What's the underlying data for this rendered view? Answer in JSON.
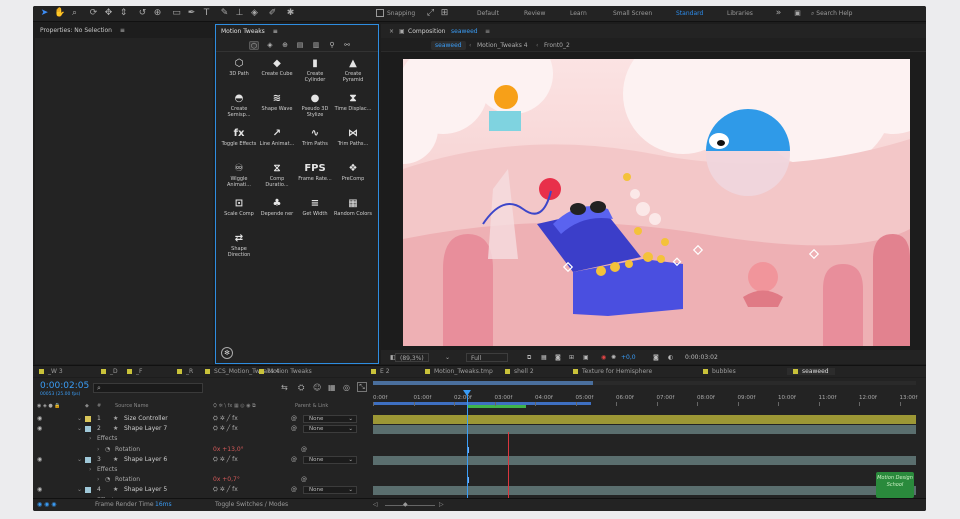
{
  "toolbar": {
    "snapping_label": "Snapping",
    "workspaces": [
      "Default",
      "Review",
      "Learn",
      "Small Screen",
      "Standard",
      "Libraries"
    ],
    "active_workspace": "Standard",
    "search_placeholder": "Search Help"
  },
  "properties": {
    "title": "Properties: No Selection"
  },
  "motion_tweaks": {
    "title": "Motion Tweaks",
    "tools": [
      {
        "icon": "3d-path-icon",
        "glyph": "⬡",
        "label": "3D Path"
      },
      {
        "icon": "cube-icon",
        "glyph": "◆",
        "label": "Create Cube"
      },
      {
        "icon": "cylinder-icon",
        "glyph": "▮",
        "label": "Create Cylinder"
      },
      {
        "icon": "pyramid-icon",
        "glyph": "▲",
        "label": "Create Pyramid"
      },
      {
        "icon": "semisphere-icon",
        "glyph": "◓",
        "label": "Create Semisp..."
      },
      {
        "icon": "wave-icon",
        "glyph": "≋",
        "label": "Shape Wave"
      },
      {
        "icon": "sphere-icon",
        "glyph": "●",
        "label": "Pseudo 3D Stylize"
      },
      {
        "icon": "hourglass-icon",
        "glyph": "⧗",
        "label": "Time Displac..."
      },
      {
        "icon": "fx-icon",
        "glyph": "fx",
        "label": "Toggle Effects"
      },
      {
        "icon": "line-animator-icon",
        "glyph": "↗",
        "label": "Line Animat..."
      },
      {
        "icon": "trim-paths-icon",
        "glyph": "∿",
        "label": "Trim Paths"
      },
      {
        "icon": "trim-paths-2-icon",
        "glyph": "⋈",
        "label": "Trim Paths..."
      },
      {
        "icon": "wiggle-icon",
        "glyph": "♾",
        "label": "Wiggle Animati..."
      },
      {
        "icon": "comp-duration-icon",
        "glyph": "⧖",
        "label": "Comp Duratio..."
      },
      {
        "icon": "fps-icon",
        "glyph": "FPS",
        "label": "Frame Rate..."
      },
      {
        "icon": "precomp-icon",
        "glyph": "❖",
        "label": "PreComp"
      },
      {
        "icon": "scale-comp-icon",
        "glyph": "⊡",
        "label": "Scale Comp"
      },
      {
        "icon": "dependencies-icon",
        "glyph": "♣",
        "label": "Depende ner"
      },
      {
        "icon": "get-width-icon",
        "glyph": "≡",
        "label": "Get Width"
      },
      {
        "icon": "random-colors-icon",
        "glyph": "▦",
        "label": "Random Colors"
      },
      {
        "icon": "shape-direction-icon",
        "glyph": "⇄",
        "label": "Shape Direction"
      }
    ]
  },
  "composition": {
    "header": "Composition",
    "comp_name": "seaweed",
    "breadcrumb": [
      "seaweed",
      "Motion_Tweaks 4",
      "Front0_2"
    ],
    "zoom": "(89,3%)",
    "resolution": "Full",
    "exposure": "+0,0",
    "timecode": "0:00:03:02"
  },
  "timeline": {
    "tabs": [
      {
        "label": "_W 3",
        "color": "#c9c23a"
      },
      {
        "label": "_D",
        "color": "#c9c23a"
      },
      {
        "label": "_F",
        "color": "#c9c23a"
      },
      {
        "label": "_R",
        "color": "#c9c23a"
      },
      {
        "label": "SCS_Motion_Tweaks 4",
        "color": "#c9c23a"
      },
      {
        "label": "Motion Tweaks",
        "color": "#c9c23a"
      },
      {
        "label": "E 2",
        "color": "#c9c23a"
      },
      {
        "label": "Motion_Tweaks.tmp",
        "color": "#c9c23a"
      },
      {
        "label": "shell 2",
        "color": "#c9c23a"
      },
      {
        "label": "Texture for Hemisphere",
        "color": "#c9c23a"
      },
      {
        "label": "bubbles",
        "color": "#c9c23a"
      },
      {
        "label": "seaweed",
        "color": "#c9c23a"
      }
    ],
    "current_time": "0:00:02:05",
    "fps_note": "00053 (25.00 fps)",
    "col_source": "Source Name",
    "col_parent": "Parent & Link",
    "ruler": [
      "0:00f",
      "01:00f",
      "02:00f",
      "03:00f",
      "04:00f",
      "05:00f",
      "06:00f",
      "07:00f",
      "08:00f",
      "09:00f",
      "10:00f",
      "11:00f",
      "12:00f",
      "13:00f"
    ],
    "layers": [
      {
        "kind": "layer",
        "num": "1",
        "name": "Size Controller",
        "color": "#d9c65a",
        "parent": "None",
        "bar": "#9c9735"
      },
      {
        "kind": "layer",
        "num": "2",
        "name": "Shape Layer 7",
        "color": "#9fc8d8",
        "parent": "None",
        "bar": "#5a6e6e"
      },
      {
        "kind": "group",
        "name": "Effects"
      },
      {
        "kind": "prop",
        "name": "Rotation",
        "value": "0x +13,0°"
      },
      {
        "kind": "layer",
        "num": "3",
        "name": "Shape Layer 6",
        "color": "#9fc8d8",
        "parent": "None",
        "bar": "#5a6e6e"
      },
      {
        "kind": "group",
        "name": "Effects"
      },
      {
        "kind": "prop",
        "name": "Rotation",
        "value": "0x +0,7°"
      },
      {
        "kind": "layer",
        "num": "4",
        "name": "Shape Layer 5",
        "color": "#9fc8d8",
        "parent": "None",
        "bar": "#5a6e6e"
      },
      {
        "kind": "group",
        "name": "Effects"
      }
    ]
  },
  "status": {
    "render_label": "Frame Render Time",
    "render_value": "16ms",
    "toggle": "Toggle Switches / Modes"
  },
  "watermark": "Motion Design School"
}
